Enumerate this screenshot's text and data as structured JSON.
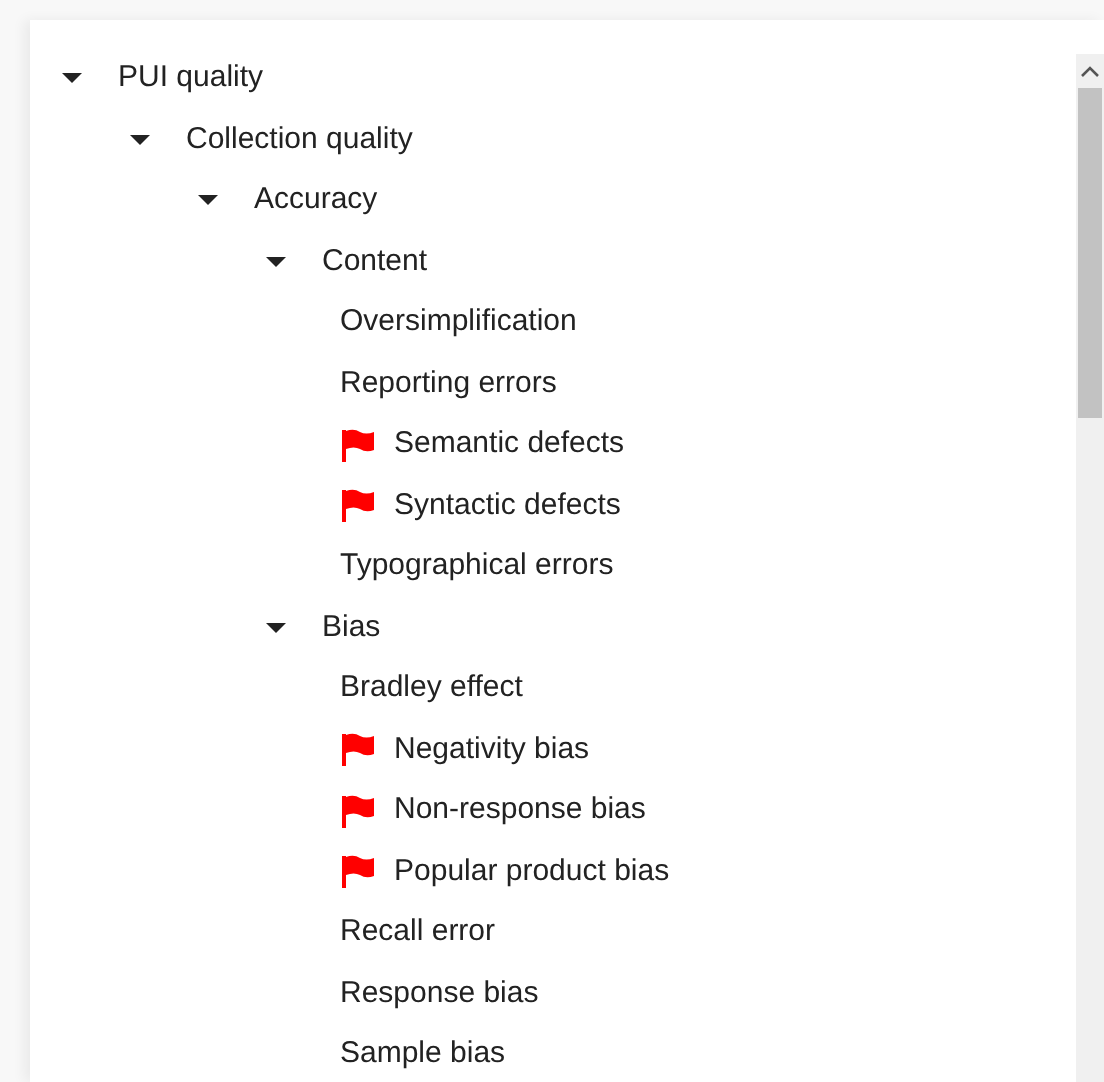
{
  "tree": [
    {
      "label": "PUI quality",
      "expanded": true,
      "children": [
        {
          "label": "Collection quality",
          "expanded": true,
          "children": [
            {
              "label": "Accuracy",
              "expanded": true,
              "children": [
                {
                  "label": "Content",
                  "expanded": true,
                  "children": [
                    {
                      "label": "Oversimplification",
                      "flagged": false
                    },
                    {
                      "label": "Reporting errors",
                      "flagged": false
                    },
                    {
                      "label": "Semantic defects",
                      "flagged": true
                    },
                    {
                      "label": "Syntactic defects",
                      "flagged": true
                    },
                    {
                      "label": "Typographical errors",
                      "flagged": false
                    }
                  ]
                },
                {
                  "label": "Bias",
                  "expanded": true,
                  "children": [
                    {
                      "label": "Bradley effect",
                      "flagged": false
                    },
                    {
                      "label": "Negativity bias",
                      "flagged": true
                    },
                    {
                      "label": "Non-response bias",
                      "flagged": true
                    },
                    {
                      "label": "Popular product bias",
                      "flagged": true
                    },
                    {
                      "label": "Recall error",
                      "flagged": false
                    },
                    {
                      "label": "Response bias",
                      "flagged": false
                    },
                    {
                      "label": "Sample bias",
                      "flagged": false
                    }
                  ]
                }
              ]
            }
          ]
        }
      ]
    }
  ]
}
